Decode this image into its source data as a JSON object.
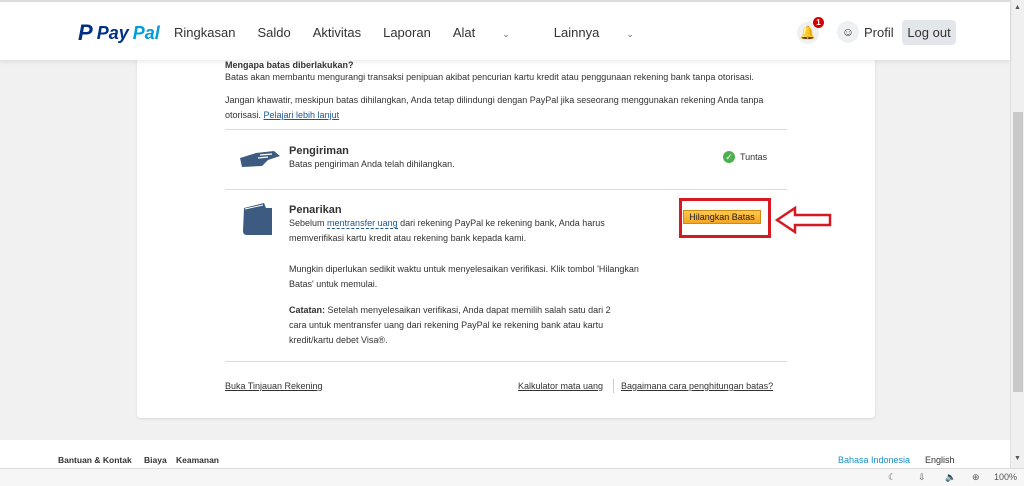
{
  "header": {
    "logo": "PayPal",
    "nav": [
      "Ringkasan",
      "Saldo",
      "Aktivitas",
      "Laporan",
      "Alat",
      "Lainnya"
    ],
    "notif_count": "1",
    "profile": "Profil",
    "logout": "Log out"
  },
  "intro": {
    "heading": "Mengapa batas diberlakukan?",
    "p1": "Batas akan membantu mengurangi transaksi penipuan akibat pencurian kartu kredit atau penggunaan rekening bank tanpa otorisasi.",
    "p2": "Jangan khawatir, meskipun batas dihilangkan, Anda tetap dilindungi dengan PayPal jika seseorang menggunakan rekening Anda tanpa otorisasi.",
    "learn_more": "Pelajari lebih lanjut"
  },
  "sending": {
    "title": "Pengiriman",
    "desc": "Batas pengiriman Anda telah dihilangkan.",
    "status": "Tuntas"
  },
  "withdraw": {
    "title": "Penarikan",
    "desc_pre": "Sebelum",
    "desc_link": "mentransfer uang",
    "desc_post": "dari rekening PayPal ke rekening bank, Anda harus memverifikasi kartu kredit atau rekening bank kepada kami.",
    "p2": "Mungkin diperlukan sedikit waktu untuk menyelesaikan verifikasi. Klik tombol 'Hilangkan Batas' untuk memulai.",
    "note_label": "Catatan:",
    "note": "Setelah menyelesaikan verifikasi, Anda dapat memilih salah satu dari 2 cara untuk mentransfer uang dari rekening PayPal ke rekening bank atau kartu kredit/kartu debet Visa®.",
    "button": "Hilangkan Batas"
  },
  "links": {
    "overview": "Buka Tinjauan Rekening",
    "calculator": "Kalkulator mata uang",
    "how": "Bagaimana cara penghitungan batas?"
  },
  "footer": {
    "help": "Bantuan & Kontak",
    "fees": "Biaya",
    "security": "Keamanan",
    "lang1": "Bahasa Indonesia",
    "lang2": "English"
  },
  "statusbar": {
    "zoom": "100%"
  },
  "colors": {
    "accent": "#1a5694",
    "button": "#f5a623",
    "highlight": "#d71921"
  }
}
